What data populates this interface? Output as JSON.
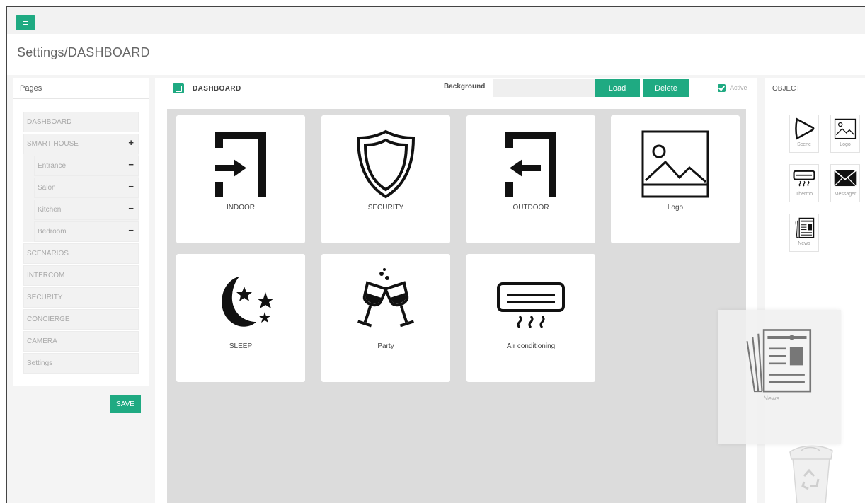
{
  "header": {
    "title": "Settings/DASHBOARD"
  },
  "pages": {
    "title": "Pages",
    "items": [
      {
        "label": "DASHBOARD"
      },
      {
        "label": "SMART HOUSE",
        "control": "+"
      },
      {
        "label": "Entrance",
        "control": "−"
      },
      {
        "label": "Salon",
        "control": "−"
      },
      {
        "label": "Kitchen",
        "control": "−"
      },
      {
        "label": "Bedroom",
        "control": "−"
      },
      {
        "label": "SCENARIOS"
      },
      {
        "label": "INTERCOM"
      },
      {
        "label": "SECURITY"
      },
      {
        "label": "CONCIERGE"
      },
      {
        "label": "CAMERA"
      },
      {
        "label": "Settings"
      }
    ],
    "save_label": "SAVE"
  },
  "dashboard": {
    "title": "DASHBOARD",
    "background_label": "Background",
    "background_value": "",
    "load_label": "Load",
    "delete_label": "Delete",
    "active_label": "Active",
    "tiles": [
      {
        "label": "INDOOR",
        "icon": "indoor-icon"
      },
      {
        "label": "SECURITY",
        "icon": "shield-icon"
      },
      {
        "label": "OUTDOOR",
        "icon": "outdoor-icon"
      },
      {
        "label": "Logo",
        "icon": "image-icon"
      },
      {
        "label": "SLEEP",
        "icon": "moon-stars-icon"
      },
      {
        "label": "Party",
        "icon": "wine-glasses-icon"
      },
      {
        "label": "Air conditioning",
        "icon": "air-conditioner-icon"
      }
    ]
  },
  "objects": {
    "title": "OBJECT",
    "items": [
      {
        "label": "Scene",
        "icon": "scene-icon"
      },
      {
        "label": "Logo",
        "icon": "image-icon"
      },
      {
        "label": "Thermo",
        "icon": "thermo-icon"
      },
      {
        "label": "Messager",
        "icon": "envelope-icon"
      },
      {
        "label": "News",
        "icon": "newspaper-icon"
      }
    ]
  },
  "drag_preview": {
    "label": "News",
    "icon": "newspaper-icon"
  },
  "colors": {
    "accent": "#1faa82",
    "canvas": "#dcdcdc"
  }
}
